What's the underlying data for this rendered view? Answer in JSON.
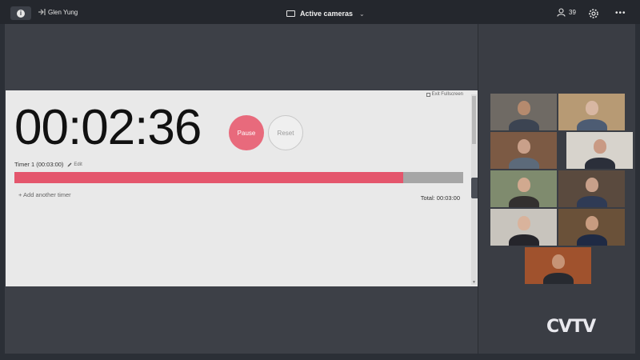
{
  "topbar": {
    "user_name": "Glen Yung",
    "view_label": "Active cameras",
    "participant_count": "39"
  },
  "timer": {
    "exit_fullscreen": "Exit Fullscreen",
    "clock": "00:02:36",
    "pause_label": "Pause",
    "reset_label": "Reset",
    "timer_name": "Timer 1 (00:03:00)",
    "edit_label": "Edit",
    "progress_fraction": 0.867,
    "add_timer_label": "+ Add another timer",
    "total_label": "Total: 00:03:00"
  },
  "gallery": {
    "tiles": [
      {
        "name": "participant-video-1",
        "bg": "#6f6a64",
        "skin": "#b58a6e",
        "shirt": "#3c4452"
      },
      {
        "name": "participant-video-2",
        "bg": "#b79a74",
        "skin": "#d8b7a2",
        "shirt": "#4d5c73"
      },
      {
        "name": "participant-video-3",
        "bg": "#7c5a44",
        "skin": "#c9a08a",
        "shirt": "#5c6a7a"
      },
      {
        "name": "participant-video-4",
        "bg": "#d7d3cc",
        "skin": "#c99a84",
        "shirt": "#2b2f3a"
      },
      {
        "name": "participant-video-5",
        "bg": "#7f8b6e",
        "skin": "#d1a98f",
        "shirt": "#33302f"
      },
      {
        "name": "participant-video-6",
        "bg": "#5a4a3e",
        "skin": "#c8a08a",
        "shirt": "#2f3b55"
      },
      {
        "name": "participant-video-7",
        "bg": "#c8c4bd",
        "skin": "#d9b39c",
        "shirt": "#25252b"
      },
      {
        "name": "participant-video-8",
        "bg": "#6a5139",
        "skin": "#c89c80",
        "shirt": "#1f2a44"
      },
      {
        "name": "participant-video-9",
        "bg": "#a0522d",
        "skin": "#c69476",
        "shirt": "#272a30"
      }
    ]
  },
  "branding": {
    "logo_text": "CVTV"
  }
}
